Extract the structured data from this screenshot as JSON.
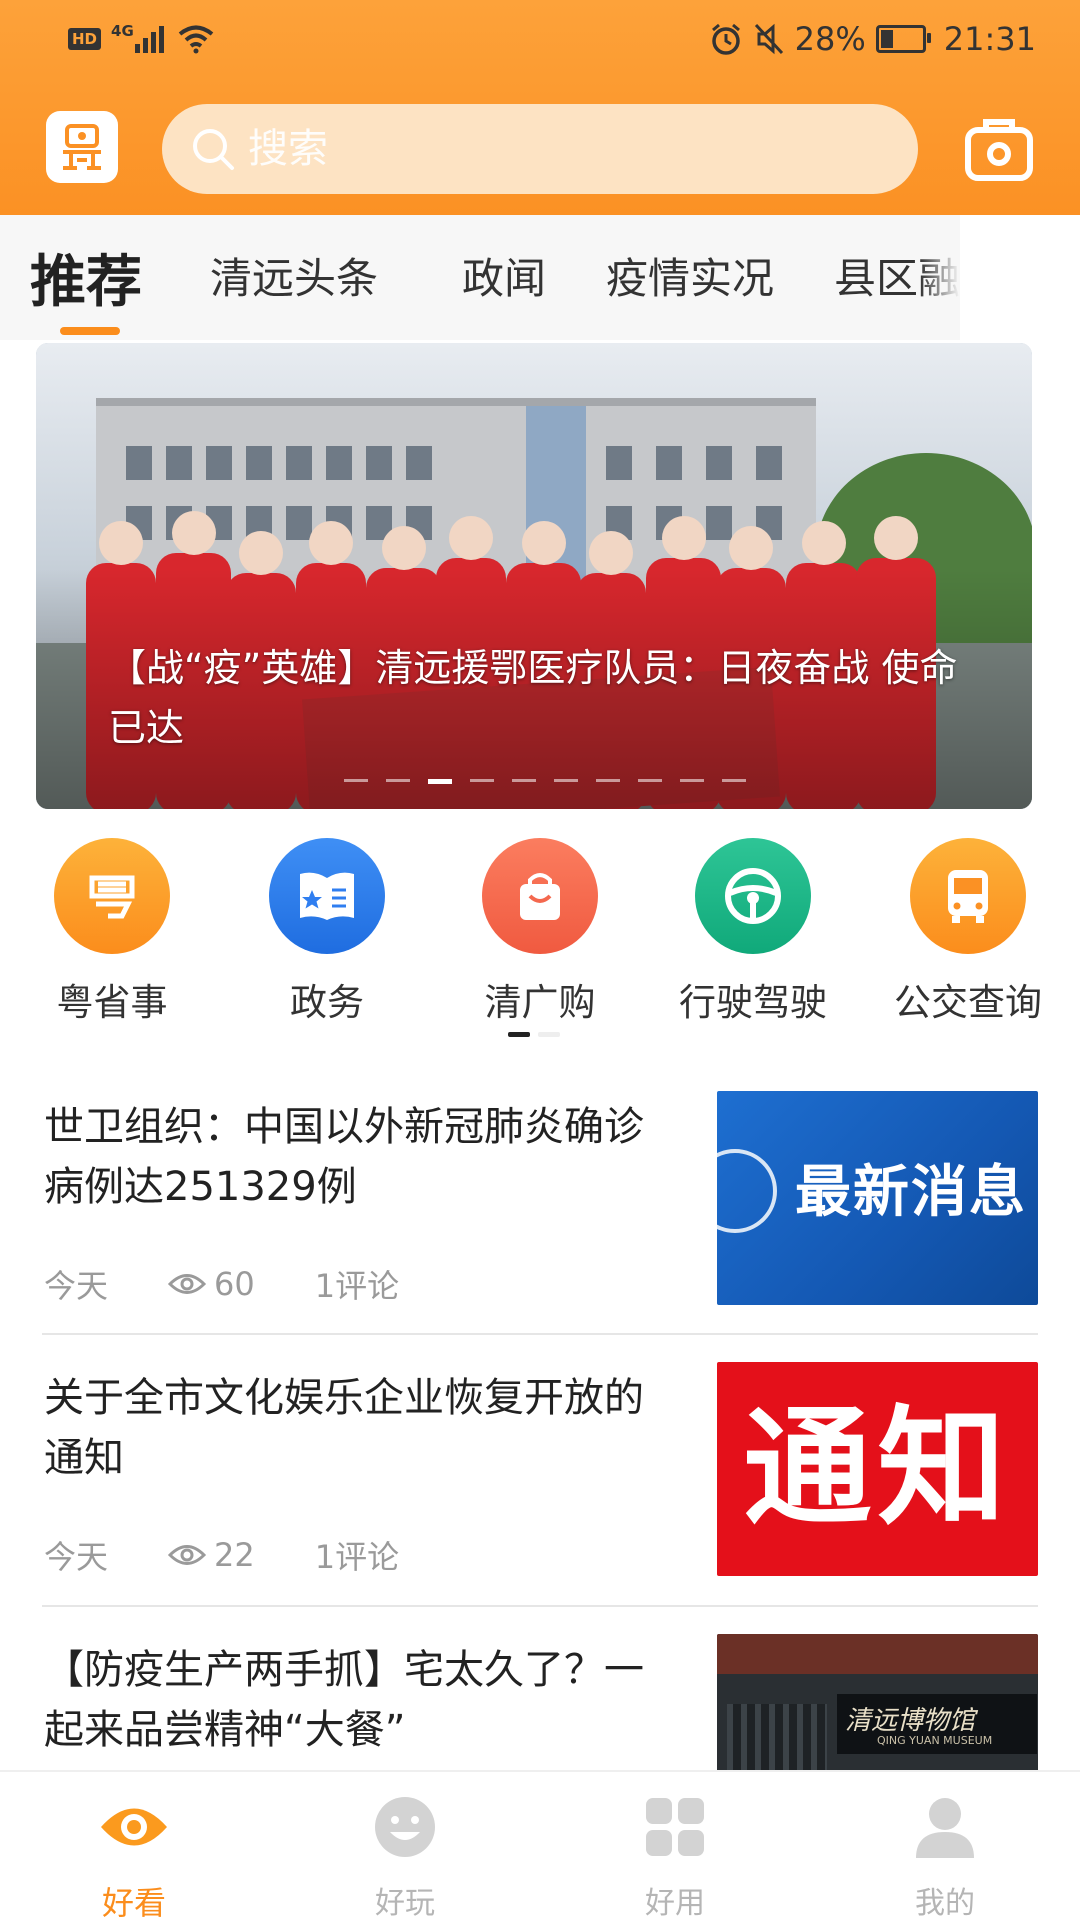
{
  "status_bar": {
    "hd": "HD",
    "network": "4G",
    "battery": "28%",
    "time": "21:31"
  },
  "header": {
    "search_placeholder": "搜索",
    "accent_color": "#fb9124"
  },
  "tabs": [
    {
      "label": "推荐",
      "active": true
    },
    {
      "label": "清远头条"
    },
    {
      "label": "政闻"
    },
    {
      "label": "疫情实况"
    },
    {
      "label": "县区融"
    }
  ],
  "banner": {
    "caption": "【战“疫”英雄】清远援鄂医疗队员：日夜奋战 使命已达",
    "slide_count": 10,
    "active_slide": 3
  },
  "quick_links": [
    {
      "label": "粤省事",
      "icon": "yue-icon",
      "color": "#fc9a24"
    },
    {
      "label": "政务",
      "icon": "gov-book-icon",
      "color": "#2f7ef0"
    },
    {
      "label": "清广购",
      "icon": "shopping-bag-icon",
      "color": "#f4684e"
    },
    {
      "label": "行驶驾驶",
      "icon": "steering-wheel-icon",
      "color": "#19b787"
    },
    {
      "label": "公交查询",
      "icon": "bus-icon",
      "color": "#fc9a24"
    }
  ],
  "news": [
    {
      "title": "世卫组织：中国以外新冠肺炎确诊病例达251329例",
      "date": "今天",
      "views": "60",
      "comments": "1评论",
      "thumb_text": "最新消息"
    },
    {
      "title": "关于全市文化娱乐企业恢复开放的通知",
      "date": "今天",
      "views": "22",
      "comments": "1评论",
      "thumb_text": "通知"
    },
    {
      "title": "【防疫生产两手抓】宅太久了？一起来品尝精神“大餐”",
      "thumb_text": "清远博物馆",
      "thumb_subtext": "QING YUAN MUSEUM"
    }
  ],
  "bottom_nav": [
    {
      "label": "好看",
      "icon": "eye-icon",
      "active": true
    },
    {
      "label": "好玩",
      "icon": "smile-icon"
    },
    {
      "label": "好用",
      "icon": "grid-icon"
    },
    {
      "label": "我的",
      "icon": "user-icon"
    }
  ]
}
